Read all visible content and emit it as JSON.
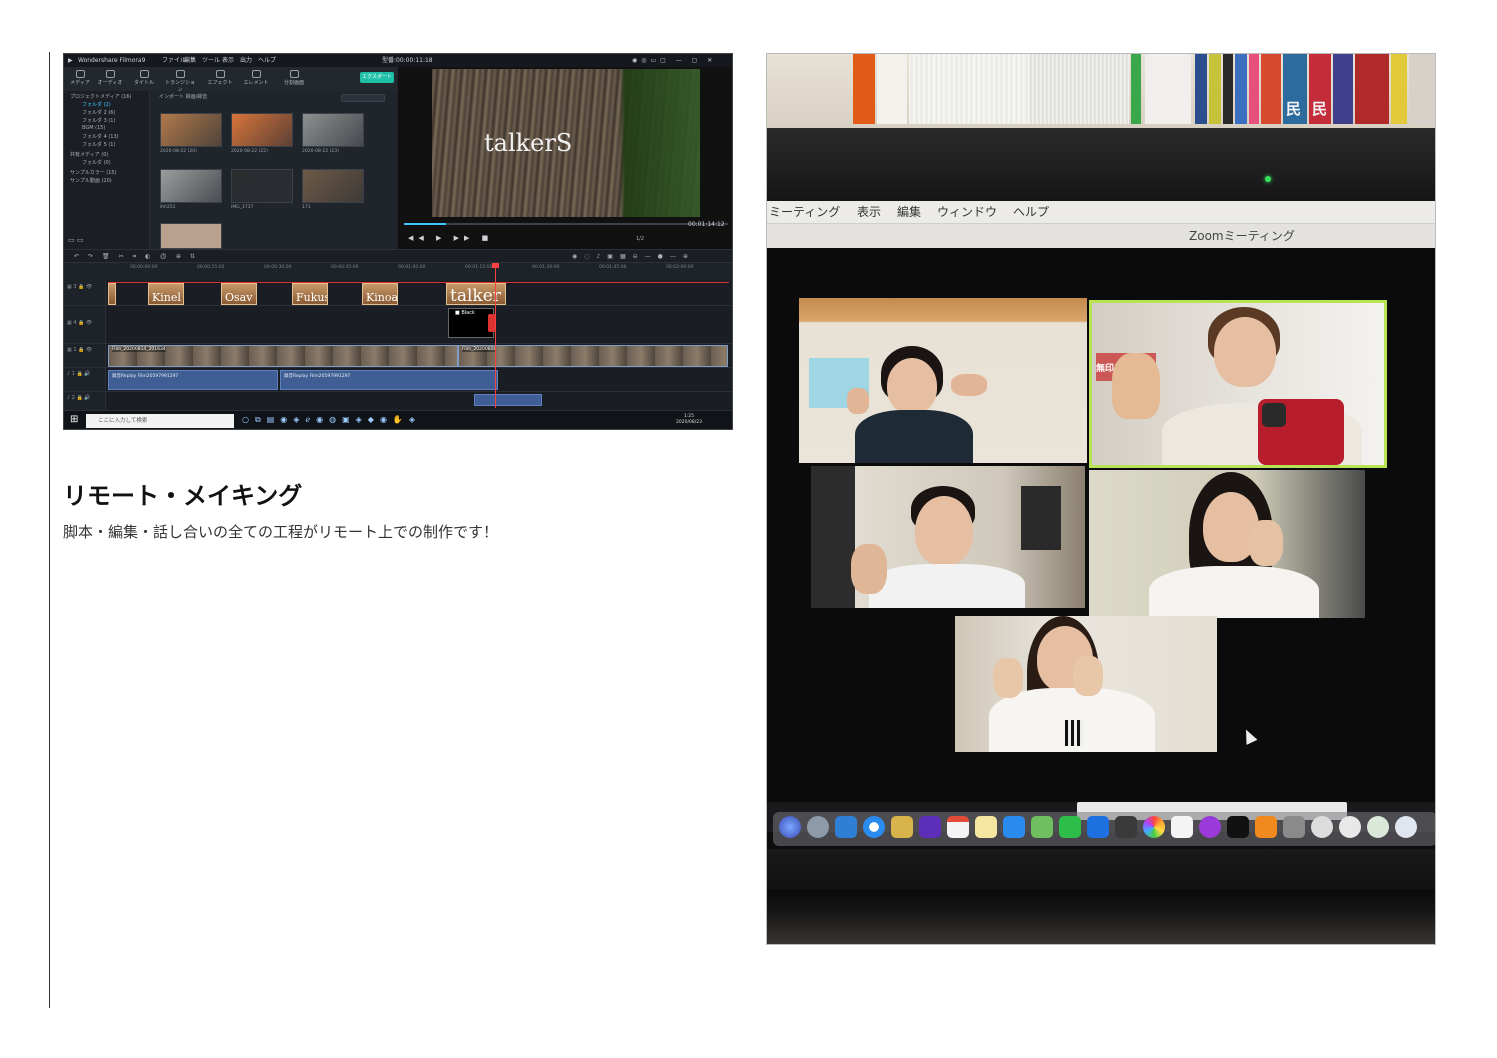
{
  "editor": {
    "app_title": "Wondershare Filmora9",
    "menu": [
      "ファイル",
      "編集",
      "ツール",
      "表示",
      "出力",
      "ヘルプ"
    ],
    "project_time": "型番:00:00:11:18",
    "toolbar": [
      "メディア",
      "オーディオ",
      "タイトル",
      "トランジション",
      "エフェクト",
      "エレメント",
      "分割画面"
    ],
    "export_label": "エクスポート",
    "sidebar": [
      "プロジェクトメディア (16)",
      "フォルダ (2)",
      "フォルダ 2 (6)",
      "フォルダ 3 (1)",
      "BGM (15)",
      "フォルダ 4 (13)",
      "フォルダ 5 (1)",
      "共有メディア (0)",
      "フォルダ (0)",
      "サンプルカラー (15)",
      "サンプル動画 (20)"
    ],
    "library_tabs": "インポート    録画/録音",
    "thumbnails": [
      {
        "caption": "2020-08-22 (20)",
        "color": "#b07a4a"
      },
      {
        "caption": "2020-08-22 (22)",
        "color": "#d8743a"
      },
      {
        "caption": "2020-08-22 (23)",
        "color": "#8d8f91"
      },
      {
        "caption": "ihh251",
        "color": "#9a9c9e"
      },
      {
        "caption": "IMG_1737",
        "color": "#2a2c30"
      },
      {
        "caption": "171",
        "color": "#6e5a46"
      }
    ],
    "preview_text": "talkerS",
    "preview_time": "00:01:14:12",
    "preview_ratio": "1/2",
    "ruler": [
      "00:00:00:00",
      "00:00:15:00",
      "00:00:30:00",
      "00:00:45:00",
      "00:01:00:00",
      "00:01:15:00",
      "00:01:30:00",
      "00:01:45:00",
      "00:02:00:00",
      "00:02:15:00"
    ],
    "title_clips": [
      "Kinel",
      "Osav",
      "Fukus",
      "Kinoa",
      "talker"
    ],
    "black_clip": "Black",
    "video_clip_labels": [
      "Film_20200814_201634",
      "Film_20200808"
    ],
    "audio_clip_labels": [
      "録音Replay Film20597991297",
      "録音Replay Film20597991297"
    ],
    "taskbar_search": "ここに入力して検索",
    "clock_time": "1:25",
    "clock_date": "2020/08/23"
  },
  "section": {
    "heading": "リモート・メイキング",
    "body": "脚本・編集・話し合いの全ての工程がリモート上での制作です！"
  },
  "photo": {
    "book_labels": [
      "民",
      "民"
    ],
    "mac_menu": [
      "ミーティング",
      "表示",
      "編集",
      "ウィンドウ",
      "ヘルプ"
    ],
    "zoom_window_title": "Zoomミーティング",
    "tile_sign": "無印良",
    "accent_colors": {
      "active_speaker": "#b8e356",
      "camera_led": "#38e05a",
      "export_button": "#20c0a8"
    }
  }
}
